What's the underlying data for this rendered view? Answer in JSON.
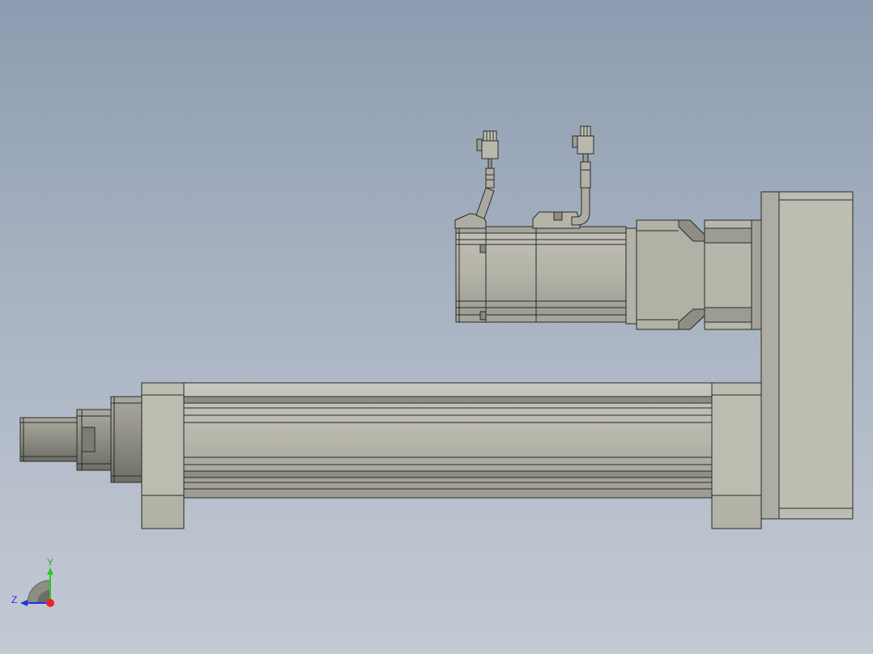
{
  "viewport": {
    "background_top": "#8c9cb0",
    "background_bottom": "#c4cad4"
  },
  "model": {
    "body_color": "#b9b8ad",
    "shade_color": "#8e8d84",
    "dark_color": "#6d6c66",
    "line_color": "#2a2a2a"
  },
  "triad": {
    "y_label": "Y",
    "z_label": "Z",
    "y_color": "#22cc22",
    "z_color": "#2233dd",
    "x_color": "#ee2222"
  }
}
